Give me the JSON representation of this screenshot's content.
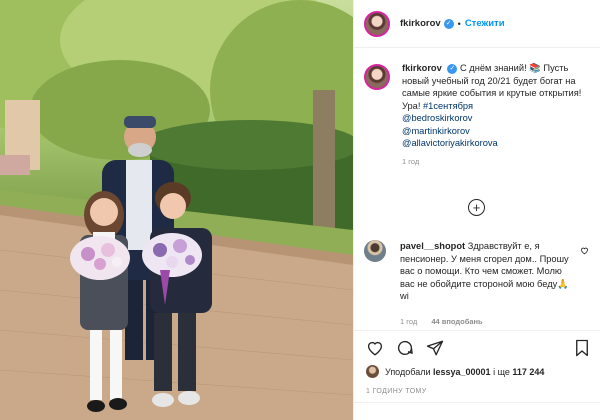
{
  "post": {
    "username": "fkirkorov",
    "follow_label": "Стежити",
    "dot": "•",
    "verified_mark": "✓"
  },
  "caption": {
    "username": "fkirkorov",
    "line1": "С днём знаний!",
    "emoji": "📚",
    "text": "Пусть новый учебный год 20/21 будет богат на самые яркие события и крутые открытия! Ура!",
    "hashtag": "#1сентября",
    "mentions": [
      "@bedroskirkorov",
      "@martinkirkorov",
      "@allavictoriyakirkorova"
    ],
    "time": "1 год"
  },
  "comment": {
    "username": "pavel__shopot",
    "text": "Здравствуйт е, я пенсионер. У меня сгорел дом.. Прошу вас о помощи. Кто чем сможет. Молю вас не обойдите стороной мою беду🙏 wi",
    "time": "1 год",
    "likes": "44 вподобань"
  },
  "likes": {
    "prefix": "Уподобали",
    "user": "lessya_00001",
    "middle": "і ще",
    "count": "117 244"
  },
  "posted_ago": "1 ГОДИНУ ТОМУ",
  "icons": {
    "load_more": "+",
    "heart": "heart-icon",
    "comment": "comment-icon",
    "share": "share-icon",
    "save": "bookmark-icon"
  },
  "colors": {
    "accent": "#0095f6",
    "verified": "#3897f0",
    "link": "#00376b",
    "muted": "#8e8e8e"
  }
}
